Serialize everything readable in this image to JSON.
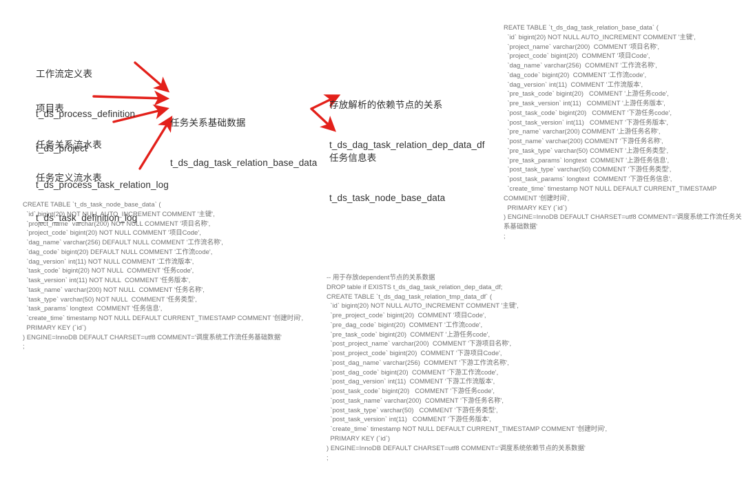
{
  "theme": {
    "background": "#ffffff",
    "arrow_color": "#e3201a",
    "label_color": "#2f2f2f",
    "sql_color": "#6f6f6f"
  },
  "diagram": {
    "sources": [
      {
        "id": "process-definition",
        "cn": "工作流定义表",
        "table": "t_ds_process_definition"
      },
      {
        "id": "project",
        "cn": "项目表",
        "table": "t_ds_project"
      },
      {
        "id": "process-task-relation-log",
        "cn": "任务关系流水表",
        "table": "t_ds_process_task_relation_log"
      },
      {
        "id": "task-definition-log",
        "cn": "任务定义流水表",
        "table": "t_ds_task_definition_log"
      }
    ],
    "center": {
      "id": "dag-task-relation-base-data",
      "cn": "任务关系基础数据",
      "table": "t_ds_dag_task_relation_base_data"
    },
    "targets": [
      {
        "id": "dag-task-relation-dep-data-df",
        "cn": "存放解析的依赖节点的关系",
        "table": "t_ds_dag_task_relation_dep_data_df"
      },
      {
        "id": "task-node-base-data",
        "cn": "任务信息表",
        "table": "t_ds_task_node_base_data"
      }
    ]
  },
  "sql_blocks": {
    "dag_task_relation_base_data": {
      "name": "t_ds_dag_task_relation_base_data",
      "lines": [
        "REATE TABLE `t_ds_dag_task_relation_base_data` (",
        "  `id` bigint(20) NOT NULL AUTO_INCREMENT COMMENT '主键',",
        "  `project_name` varchar(200)  COMMENT '项目名称',",
        "  `project_code` bigint(20)  COMMENT '项目Code',",
        "  `dag_name` varchar(256)  COMMENT '工作流名称',",
        "  `dag_code` bigint(20)  COMMENT '工作流code',",
        "  `dag_version` int(11)  COMMENT '工作流版本',",
        "  `pre_task_code` bigint(20)   COMMENT '上游任务code',",
        "  `pre_task_version` int(11)   COMMENT '上游任务版本',",
        "  `post_task_code` bigint(20)   COMMENT '下游任务code',",
        "  `post_task_version` int(11)   COMMENT '下游任务版本',",
        "  `pre_name` varchar(200) COMMENT '上游任务名称',",
        "  `post_name` varchar(200) COMMENT '下游任务名称',",
        "  `pre_task_type` varchar(50) COMMENT '上游任务类型',",
        "  `pre_task_params` longtext  COMMENT '上游任务信息',",
        "  `post_task_type` varchar(50) COMMENT '下游任务类型',",
        "  `post_task_params` longtext  COMMENT '下游任务信息',",
        "  `create_time` timestamp NOT NULL DEFAULT CURRENT_TIMESTAMP COMMENT '创建时间',",
        "  PRIMARY KEY (`id`)",
        ") ENGINE=InnoDB DEFAULT CHARSET=utf8 COMMENT='调度系统工作流任务关系基础数据'",
        ";"
      ]
    },
    "task_node_base_data": {
      "name": "t_ds_task_node_base_data",
      "lines": [
        "CREATE TABLE `t_ds_task_node_base_data` (",
        "  `id` bigint(20) NOT NULL AUTO_INCREMENT COMMENT '主键',",
        "  `project_name` varchar(200) NOT NULL COMMENT '项目名称',",
        "  `project_code` bigint(20) NOT NULL COMMENT '项目Code',",
        "  `dag_name` varchar(256) DEFAULT NULL COMMENT '工作流名称',",
        "  `dag_code` bigint(20) DEFAULT NULL COMMENT '工作流code',",
        "  `dag_version` int(11) NOT NULL COMMENT '工作流版本',",
        "  `task_code` bigint(20) NOT NULL  COMMENT '任务code',",
        "  `task_version` int(11) NOT NULL  COMMENT '任务版本',",
        "  `task_name` varchar(200) NOT NULL  COMMENT '任务名称',",
        "  `task_type` varchar(50) NOT NULL  COMMENT '任务类型',",
        "  `task_params` longtext  COMMENT '任务信息',",
        "  `create_time` timestamp NOT NULL DEFAULT CURRENT_TIMESTAMP COMMENT '创建时间',",
        "  PRIMARY KEY (`id`)",
        ") ENGINE=InnoDB DEFAULT CHARSET=utf8 COMMENT='调度系统工作流任务基础数据'",
        ";"
      ]
    },
    "dag_task_relation_tmp_data_df": {
      "name": "t_ds_dag_task_relation_tmp_data_df",
      "lines": [
        "-- 用于存放dependent节点的关系数据",
        "DROP table if EXISTS t_ds_dag_task_relation_dep_data_df;",
        "CREATE TABLE `t_ds_dag_task_relation_tmp_data_df` (",
        "  `id` bigint(20) NOT NULL AUTO_INCREMENT COMMENT '主键',",
        "  `pre_project_code` bigint(20)  COMMENT '项目Code',",
        "  `pre_dag_code` bigint(20)  COMMENT '工作流code',",
        "  `pre_task_code` bigint(20)  COMMENT '上游任务code',",
        "  `post_project_name` varchar(200)  COMMENT '下游项目名称',",
        "  `post_project_code` bigint(20)  COMMENT '下游项目Code',",
        "  `post_dag_name` varchar(256)  COMMENT '下游工作流名称',",
        "  `post_dag_code` bigint(20)  COMMENT '下游工作流code',",
        "  `post_dag_version` int(11)  COMMENT '下游工作流版本',",
        "  `post_task_code` bigint(20)   COMMENT '下游任务code',",
        "  `post_task_name` varchar(200)  COMMENT '下游任务名称',",
        "  `post_task_type` varchar(50)   COMMENT '下游任务类型',",
        "  `post_task_version` int(11)   COMMENT '下游任务版本',",
        "  `create_time` timestamp NOT NULL DEFAULT CURRENT_TIMESTAMP COMMENT '创建时间',",
        "  PRIMARY KEY (`id`)",
        ") ENGINE=InnoDB DEFAULT CHARSET=utf8 COMMENT='调度系统依赖节点的关系数据'",
        ";"
      ]
    }
  }
}
